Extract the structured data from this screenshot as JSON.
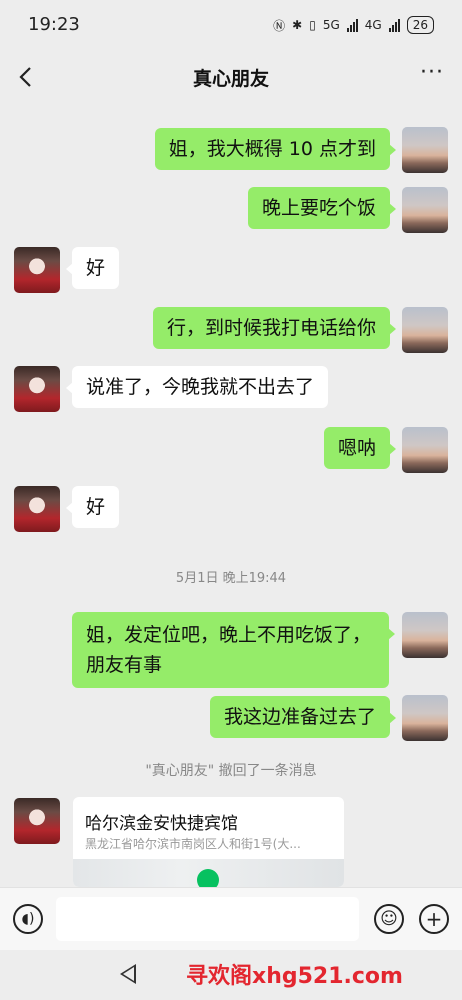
{
  "status_bar": {
    "time": "19:23",
    "network_5g": "5G",
    "network_4g": "4G",
    "battery": "26"
  },
  "nav": {
    "title": "真心朋友"
  },
  "messages": [
    {
      "from": "me",
      "text": "姐，我大概得 10 点才到"
    },
    {
      "from": "me",
      "text": "晚上要吃个饭"
    },
    {
      "from": "other",
      "text": "好"
    },
    {
      "from": "me",
      "text": "行，到时候我打电话给你"
    },
    {
      "from": "other",
      "text": "说准了，今晚我就不出去了"
    },
    {
      "from": "me",
      "text": "嗯呐"
    },
    {
      "from": "other",
      "text": "好"
    },
    {
      "from": "me",
      "text": "姐，发定位吧，晚上不用吃饭了，朋友有事"
    },
    {
      "from": "me",
      "text": "我这边准备过去了"
    }
  ],
  "timestamp": "5月1日 晚上19:44",
  "recall_notice": "\"真心朋友\" 撤回了一条消息",
  "location_card": {
    "name": "哈尔滨金安快捷宾馆",
    "address": "黑龙江省哈尔滨市南岗区人和街1号(大..."
  },
  "watermark": "寻欢阁xhg521.com",
  "icons": {
    "back": "chevron-left-icon",
    "more": "more-dots-icon",
    "voice": "voice-icon",
    "emoji": "emoji-icon",
    "add": "plus-icon"
  },
  "colors": {
    "bubble_self": "#95ec69",
    "bubble_other": "#ffffff",
    "background": "#ededed",
    "watermark": "#e3262f"
  }
}
